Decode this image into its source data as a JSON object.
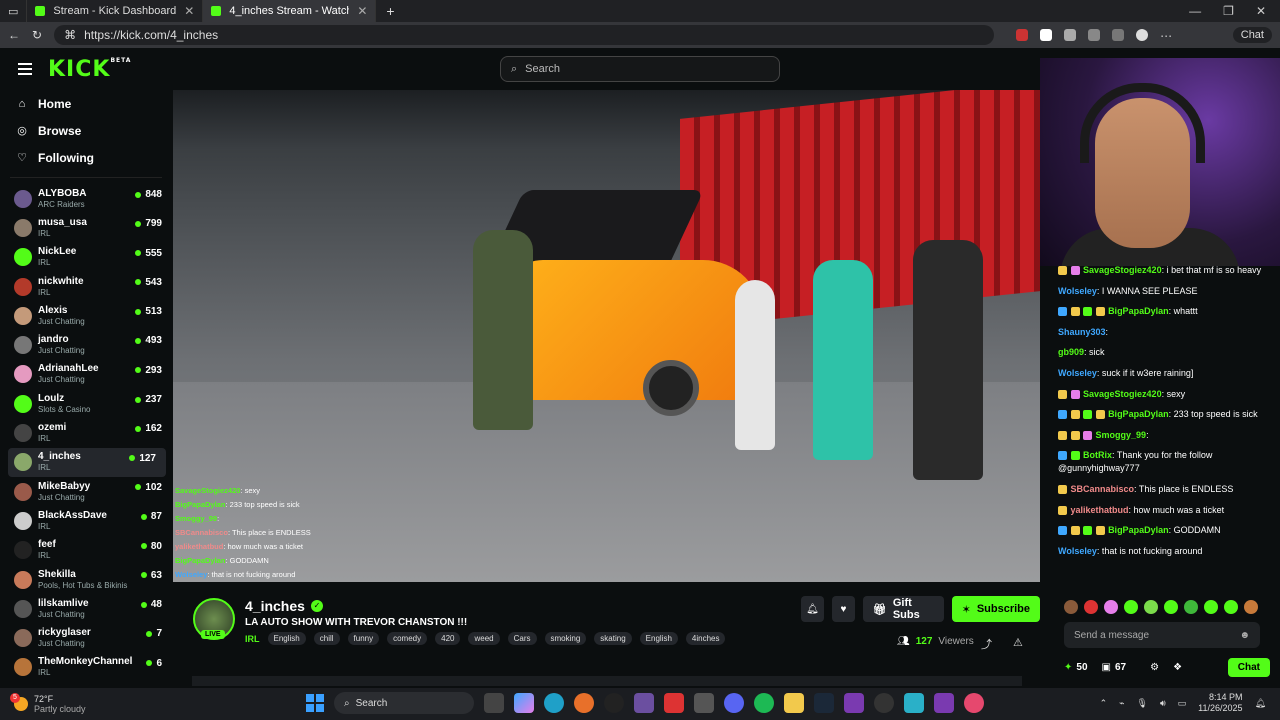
{
  "browser": {
    "tabs": [
      {
        "label": "Stream - Kick Dashboard"
      },
      {
        "label": "4_inches Stream - Watch Live on Kick"
      }
    ],
    "url": "https://kick.com/4_inches",
    "chat_label": "Chat"
  },
  "topbar": {
    "logo": "KICK",
    "logo_badge": "BETA",
    "search_placeholder": "Search"
  },
  "sidebar": {
    "nav": [
      {
        "label": "Home",
        "icon": "home-icon"
      },
      {
        "label": "Browse",
        "icon": "compass-icon"
      },
      {
        "label": "Following",
        "icon": "heart-icon"
      }
    ],
    "channels": [
      {
        "name": "ALYBOBA",
        "category": "ARC Raiders",
        "viewers": "848",
        "color": "#6b5a8e"
      },
      {
        "name": "musa_usa",
        "category": "IRL",
        "viewers": "799",
        "color": "#8a7a6a"
      },
      {
        "name": "NickLee",
        "category": "IRL",
        "viewers": "555",
        "color": "#53fc18"
      },
      {
        "name": "nickwhite",
        "category": "IRL",
        "viewers": "543",
        "color": "#b33a2a"
      },
      {
        "name": "Alexis",
        "category": "Just Chatting",
        "viewers": "513",
        "color": "#c49a7a"
      },
      {
        "name": "jandro",
        "category": "Just Chatting",
        "viewers": "493",
        "color": "#777"
      },
      {
        "name": "AdrianahLee",
        "category": "Just Chatting",
        "viewers": "293",
        "color": "#e59ac0"
      },
      {
        "name": "Loulz",
        "category": "Slots & Casino",
        "viewers": "237",
        "color": "#53fc18"
      },
      {
        "name": "ozemi",
        "category": "IRL",
        "viewers": "162",
        "color": "#444"
      },
      {
        "name": "4_inches",
        "category": "IRL",
        "viewers": "127",
        "color": "#8aa86a"
      },
      {
        "name": "MikeBabyy",
        "category": "Just Chatting",
        "viewers": "102",
        "color": "#9a5a4a"
      },
      {
        "name": "BlackAssDave",
        "category": "IRL",
        "viewers": "87",
        "color": "#ccc"
      },
      {
        "name": "feef",
        "category": "IRL",
        "viewers": "80",
        "color": "#222"
      },
      {
        "name": "Shekilla",
        "category": "Pools, Hot Tubs & Bikinis",
        "viewers": "63",
        "color": "#c87a5a"
      },
      {
        "name": "lilskamlive",
        "category": "Just Chatting",
        "viewers": "48",
        "color": "#555"
      },
      {
        "name": "rickyglaser",
        "category": "Just Chatting",
        "viewers": "7",
        "color": "#8a6a5a"
      },
      {
        "name": "TheMonkeyChannel",
        "category": "IRL",
        "viewers": "6",
        "color": "#b7743a"
      }
    ]
  },
  "overlay_chat": [
    {
      "user": "SavageStogiez420",
      "text": ": sexy"
    },
    {
      "user": "BigPapaDylan",
      "text": ": 233 top speed is sick"
    },
    {
      "user": "Smoggy_99",
      "text": ":"
    },
    {
      "user": "SBCannabisco",
      "text": ": This place is ENDLESS"
    },
    {
      "user": "yalikethatbud",
      "text": ": how much was a ticket"
    },
    {
      "user": "BigPapaDylan",
      "text": ": GODDAMN"
    },
    {
      "user": "Wolseley",
      "text": ": that is not fucking around"
    }
  ],
  "chat": {
    "messages": [
      {
        "user": "SavageStogiez420",
        "color": "#53fc18",
        "text": ": i bet that mf is so heavy",
        "badges": [
          "#f2c94c",
          "#e67eea"
        ]
      },
      {
        "user": "Wolseley",
        "color": "#3fa8ff",
        "text": ": I WANNA SEE PLEASE",
        "badges": []
      },
      {
        "user": "BigPapaDylan",
        "color": "#53fc18",
        "text": ": whattt",
        "badges": [
          "#3fa8ff",
          "#f2c94c",
          "#53fc18",
          "#f2c94c"
        ]
      },
      {
        "user": "Shauny303",
        "color": "#3fa8ff",
        "text": ":",
        "badges": []
      },
      {
        "user": "gb909",
        "color": "#53fc18",
        "text": ": sick",
        "badges": []
      },
      {
        "user": "Wolseley",
        "color": "#3fa8ff",
        "text": ": suck if it w3ere raining]",
        "badges": []
      },
      {
        "user": "SavageStogiez420",
        "color": "#53fc18",
        "text": ": sexy",
        "badges": [
          "#f2c94c",
          "#e67eea"
        ]
      },
      {
        "user": "BigPapaDylan",
        "color": "#53fc18",
        "text": ": 233 top speed is sick",
        "badges": [
          "#3fa8ff",
          "#f2c94c",
          "#53fc18",
          "#f2c94c"
        ]
      },
      {
        "user": "Smoggy_99",
        "color": "#53fc18",
        "text": ":",
        "badges": [
          "#f2c94c",
          "#f2c94c",
          "#e67eea"
        ]
      },
      {
        "user": "BotRix",
        "color": "#53fc18",
        "text": ": Thank you for the follow @gunnyhighway777",
        "badges": [
          "#3fa8ff",
          "#53fc18"
        ]
      },
      {
        "user": "SBCannabisco",
        "color": "#f08a8a",
        "text": ": This place is ENDLESS",
        "badges": [
          "#f2c94c"
        ]
      },
      {
        "user": "yalikethatbud",
        "color": "#f08a8a",
        "text": ": how much was a ticket",
        "badges": [
          "#f2c94c"
        ]
      },
      {
        "user": "BigPapaDylan",
        "color": "#53fc18",
        "text": ": GODDAMN",
        "badges": [
          "#3fa8ff",
          "#f2c94c",
          "#53fc18",
          "#f2c94c"
        ]
      },
      {
        "user": "Wolseley",
        "color": "#3fa8ff",
        "text": ": that is not fucking around",
        "badges": []
      }
    ],
    "input_placeholder": "Send a message",
    "points": "50",
    "stat2": "67",
    "send_label": "Chat"
  },
  "stream": {
    "name": "4_inches",
    "live_label": "LIVE",
    "title": "LA AUTO SHOW WITH TREVOR CHANSTON !!!",
    "category": "IRL",
    "tags": [
      "English",
      "chill",
      "funny",
      "comedy",
      "420",
      "weed",
      "Cars",
      "smoking",
      "skating",
      "English",
      "4inches"
    ],
    "gift_label": "Gift Subs",
    "subscribe_label": "Subscribe",
    "viewers": "127",
    "viewers_label": "Viewers"
  },
  "taskbar": {
    "weather_temp": "72°F",
    "weather_desc": "Partly cloudy",
    "weather_badge": "5",
    "search_label": "Search",
    "time": "8:14 PM",
    "date": "11/26/2025"
  }
}
